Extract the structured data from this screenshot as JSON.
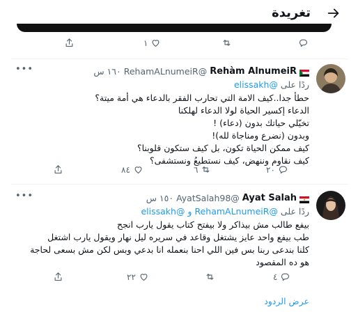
{
  "header": {
    "title": "تغريدة"
  },
  "top_actions": {
    "like_count": "١",
    "retweet_count": "",
    "reply_count": ""
  },
  "tweets": [
    {
      "name": "Rehàm AlnumeiR",
      "handle": "@RehamALnumeiR",
      "time": "١٦٠ س",
      "replying_prefix": "ردًا على",
      "mentions": [
        "@elissakh"
      ],
      "mentions_joiner": "",
      "lines": [
        "حطأ جدا..كيف الامة التي تحارب الفقر بالدعاء هي أمة ميتة؟",
        "الدعاء إكسير الحياة لولا الدعاء لهلكنا",
        "تخيّلي حياتك بدون (دعاء) !",
        "وبدون (نضرع ومناجاة لله)!",
        "كيف ممكن الحياة تكون، بل كيف ستكون قلوبنا؟",
        "كيف نقاوم وننهض، كيف نستطيعُ ونستشفى؟"
      ],
      "reply_count": "٢٠",
      "retweet_count": "٦",
      "like_count": "٨٤"
    },
    {
      "name": "Ayat Salah",
      "handle": "@AyatSalah98",
      "time": "١٥٠ س",
      "replying_prefix": "ردًا على",
      "mentions": [
        "@RehamALnumeiR",
        "@elissakh"
      ],
      "mentions_joiner": "و",
      "lines": [
        "بيفع طالب مش بيذاكر ولا بيفتح كتاب يقول يارب انجح",
        "طب بيفع واحد عايز يشتغل وقاعد في سريره ليل نهار ويقول يارب اشتغل",
        "كلنا بندعى ربنا بس فين اللي احنا بنعمله انا بدعي وبس لكن مش بسعى لحاجة",
        "هو ده المقصود"
      ],
      "reply_count": "٤",
      "retweet_count": "",
      "like_count": "٢٢"
    }
  ],
  "show_replies_label": "عرض الردود",
  "colors": {
    "accent": "#1d9bf0",
    "muted": "#536471",
    "text": "#0f1419",
    "divider": "#eff3f4"
  }
}
